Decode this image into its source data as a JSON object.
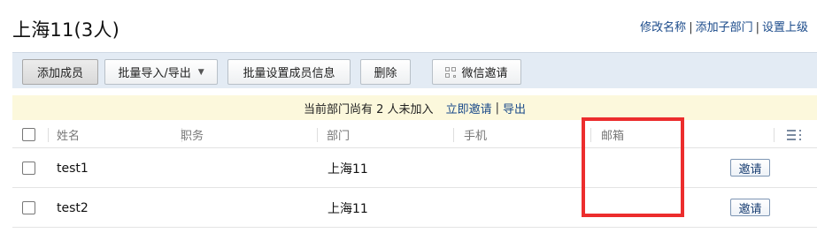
{
  "header": {
    "title": "上海11(3人)",
    "links": [
      "修改名称",
      "添加子部门",
      "设置上级"
    ],
    "link_separator": "|"
  },
  "toolbar": {
    "add_member": "添加成员",
    "bulk_import_export": "批量导入/导出",
    "bulk_import_caret": "▼",
    "bulk_set_info": "批量设置成员信息",
    "delete": "删除",
    "wechat_invite": "微信邀请"
  },
  "notice": {
    "text": "当前部门尚有 2 人未加入",
    "invite_link": "立即邀请",
    "separator": "|",
    "export_link": "导出"
  },
  "table": {
    "columns": [
      "姓名",
      "职务",
      "部门",
      "手机",
      "邮箱"
    ],
    "rows": [
      {
        "name": "test1",
        "position": "",
        "department": "上海11",
        "phone": "",
        "email": "",
        "action": "邀请"
      },
      {
        "name": "test2",
        "position": "",
        "department": "上海11",
        "phone": "",
        "email": "",
        "action": "邀请"
      }
    ]
  },
  "colors": {
    "link": "#1a4a8a",
    "toolbar_bg": "#e3ebf4",
    "notice_bg": "#fcf8dc",
    "highlight": "#ec2d2d"
  },
  "icons": {
    "column_settings": "column-menu-icon",
    "wechat_invite": "qr-code-icon"
  }
}
